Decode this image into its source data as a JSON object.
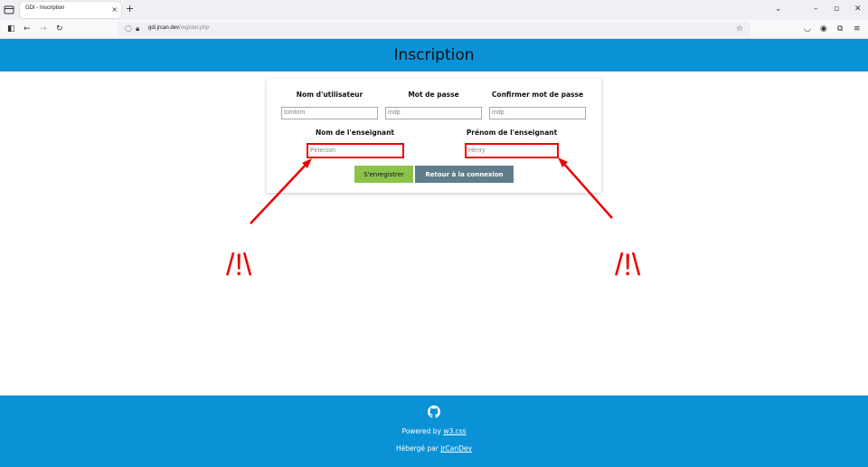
{
  "browser": {
    "tab_title": "GDI - Inscription",
    "tab_close": "×",
    "new_tab": "+",
    "url_host": "gdi.jrcan.dev",
    "url_path": "/register.php"
  },
  "header": {
    "title": "Inscription"
  },
  "form": {
    "username": {
      "label": "Nom d'utilisateur",
      "placeholder": "tomtom"
    },
    "password": {
      "label": "Mot de passe",
      "placeholder": "mdp"
    },
    "confirm": {
      "label": "Confirmer mot de passe",
      "placeholder": "mdp"
    },
    "teacher_last": {
      "label": "Nom de l'enseignant",
      "placeholder": "Peterson"
    },
    "teacher_first": {
      "label": "Prénom de l'enseignant",
      "placeholder": "Henry"
    },
    "register_label": "S'enregistrer",
    "back_label": "Retour à la connexion"
  },
  "annotations": {
    "left_warning": "/!\\",
    "right_warning": "/!\\"
  },
  "footer": {
    "powered_prefix": "Powered by ",
    "powered_link": "w3.css",
    "hosted_prefix": "Hébergé par ",
    "hosted_link": "JrCanDev"
  },
  "colors": {
    "brand": "#0b92d6",
    "warning": "#e00000",
    "register": "#8bc34a",
    "back": "#607d8b"
  }
}
